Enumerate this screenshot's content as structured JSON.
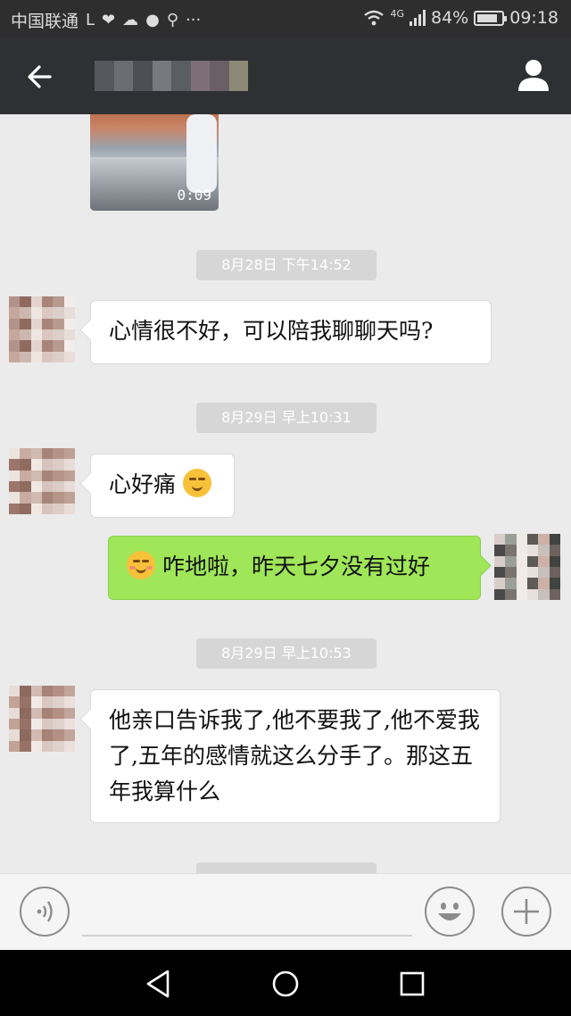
{
  "status_bar": {
    "carrier": "中国联通",
    "network": "4G",
    "battery": "84%",
    "battery_level": 0.84,
    "time": "09:18",
    "icons": [
      "network-type-icon",
      "heart-icon",
      "cloud-icon",
      "wechat-icon",
      "key-icon",
      "more-icon",
      "wifi-icon",
      "signal-icon",
      "battery-icon"
    ]
  },
  "title_bar": {
    "back_icon": "arrow-left-icon",
    "title": "",
    "profile_icon": "person-icon"
  },
  "messages": {
    "video": {
      "duration": "0:09"
    },
    "ts1": "8月28日 下午14:52",
    "msg1": "心情很不好，可以陪我聊聊天吗?",
    "ts2": "8月29日 早上10:31",
    "msg2": "心好痛",
    "msg3": "咋地啦，昨天七夕没有过好",
    "ts3": "8月29日 早上10:53",
    "msg4": "他亲口告诉我了,他不要我了,他不爱我了,五年的感情就这么分手了。那这五年我算什么"
  },
  "input_bar": {
    "voice_icon": "voice-icon",
    "emoji_icon": "smiley-icon",
    "plus_icon": "plus-icon"
  },
  "nav_bar": {
    "back_icon": "triangle-back-icon",
    "home_icon": "circle-home-icon",
    "recents_icon": "square-recents-icon"
  },
  "colors": {
    "header_bg": "#2f3033",
    "chat_bg": "#ebebeb",
    "outgoing_bubble": "#9fe658",
    "incoming_bubble": "#ffffff"
  }
}
